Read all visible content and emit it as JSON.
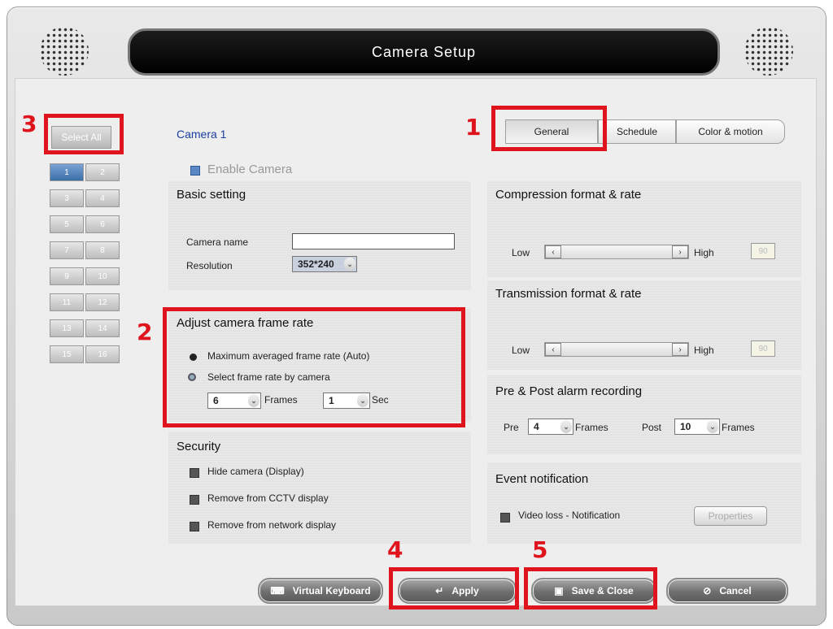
{
  "window": {
    "title": "Camera Setup"
  },
  "sidebar": {
    "select_all": "Select All",
    "cameras": [
      "1",
      "2",
      "3",
      "4",
      "5",
      "6",
      "7",
      "8",
      "9",
      "10",
      "11",
      "12",
      "13",
      "14",
      "15",
      "16"
    ]
  },
  "camera": {
    "name": "Camera 1",
    "enable_label": "Enable Camera"
  },
  "tabs": [
    "General",
    "Schedule",
    "Color & motion"
  ],
  "basic": {
    "title": "Basic setting",
    "name_label": "Camera name",
    "name_value": "",
    "resolution_label": "Resolution",
    "resolution_value": "352*240"
  },
  "framerate": {
    "title": "Adjust camera frame rate",
    "option_auto": "Maximum averaged frame rate (Auto)",
    "option_manual": "Select frame rate by camera",
    "frames_value": "6",
    "frames_label": "Frames",
    "sec_value": "1",
    "sec_label": "Sec"
  },
  "security": {
    "title": "Security",
    "options": [
      "Hide camera (Display)",
      "Remove from CCTV display",
      "Remove from network display"
    ]
  },
  "compression": {
    "title": "Compression format & rate",
    "low": "Low",
    "high": "High",
    "value": "90"
  },
  "transmission": {
    "title": "Transmission format & rate",
    "low": "Low",
    "high": "High",
    "value": "90"
  },
  "alarm": {
    "title": "Pre & Post alarm recording",
    "pre_label": "Pre",
    "pre_value": "4",
    "pre_unit": "Frames",
    "post_label": "Post",
    "post_value": "10",
    "post_unit": "Frames"
  },
  "event": {
    "title": "Event notification",
    "video_loss": "Video loss - Notification",
    "properties": "Properties"
  },
  "buttons": {
    "keyboard": "Virtual Keyboard",
    "apply": "Apply",
    "save_close": "Save & Close",
    "cancel": "Cancel"
  },
  "annotations": [
    "1",
    "2",
    "3",
    "4",
    "5"
  ],
  "colors": {
    "highlight": "#e0141c",
    "camera_title": "#1a3fa0"
  }
}
